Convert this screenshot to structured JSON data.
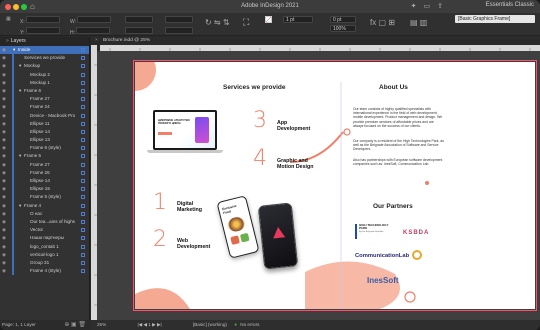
{
  "app": {
    "title": "Adobe InDesign 2021",
    "workspace": "Essentials Classic",
    "frame_type": "[Basic Graphics Frame]"
  },
  "controls": {
    "stroke_weight": "1 pt",
    "zoom_percent": "100%",
    "opacity": "0 pt"
  },
  "panel": {
    "tab_label": "Layers",
    "footer": "Page: 1, 1 Layer"
  },
  "layers": [
    {
      "label": "Inside",
      "indent": 0,
      "expanded": true,
      "main": true
    },
    {
      "label": "Services we provide",
      "indent": 1
    },
    {
      "label": "Mockup",
      "indent": 1,
      "expanded": true
    },
    {
      "label": "Mockup 2",
      "indent": 2
    },
    {
      "label": "Mockup 1",
      "indent": 2
    },
    {
      "label": "Frame 6",
      "indent": 1,
      "expanded": true
    },
    {
      "label": "Frame 27",
      "indent": 2
    },
    {
      "label": "Frame 24",
      "indent": 2
    },
    {
      "label": "Device - Macbook Pro",
      "indent": 2
    },
    {
      "label": "Ellipse 11",
      "indent": 2
    },
    {
      "label": "Ellipse 14",
      "indent": 2
    },
    {
      "label": "Ellipse 13",
      "indent": 2
    },
    {
      "label": "Frame 6 (style)",
      "indent": 2
    },
    {
      "label": "Frame 5",
      "indent": 1,
      "expanded": true
    },
    {
      "label": "Frame 27",
      "indent": 2
    },
    {
      "label": "Frame 26",
      "indent": 2
    },
    {
      "label": "Ellipse 14",
      "indent": 2
    },
    {
      "label": "Ellipse 15",
      "indent": 2
    },
    {
      "label": "Frame 5 (style)",
      "indent": 2
    },
    {
      "label": "Frame 4",
      "indent": 1,
      "expanded": true
    },
    {
      "label": "О нас",
      "indent": 2
    },
    {
      "label": "Our tea...ains of highs",
      "indent": 2
    },
    {
      "label": "Vector",
      "indent": 2
    },
    {
      "label": "Наши партнеры",
      "indent": 2
    },
    {
      "label": "logo_contab 1",
      "indent": 2
    },
    {
      "label": "vertical-logo 1",
      "indent": 2
    },
    {
      "label": "Group 31",
      "indent": 2
    },
    {
      "label": "Frame 4 (style)",
      "indent": 2
    }
  ],
  "document": {
    "tab": "Brochure.indd @ 25%",
    "status_zoom": "25%",
    "status_page": "1",
    "status_style": "[Basic] (working)",
    "status_errors": "No errors"
  },
  "brochure": {
    "services_title": "Services we provide",
    "about_title": "About Us",
    "partners_title": "Our Partners",
    "services": [
      {
        "num": "1",
        "label": "Digital\nMarketing"
      },
      {
        "num": "2",
        "label": "Web\nDevelopment"
      },
      {
        "num": "3",
        "label": "App\nDevelopment"
      },
      {
        "num": "4",
        "label": "Graphic and\nMotion Design"
      }
    ],
    "about_paragraphs": [
      "Our team consists of highly qualified specialists with international experience in the field of web development, mobile development. Product management and design. We provide premium services of affordable prices and are always focused on the success of our clients.",
      "Our company is a resident of the High Technologies Park, as well as the Belgrade Association of Software and Service Developers.",
      "Also has partnerships with European software development companies such as: InesSoft, Communication Lab"
    ],
    "partners": [
      {
        "name": "HIGH TECHNOLOGY PARK",
        "sub": "By the Belgrade Republic"
      },
      {
        "name": "KSBDA"
      },
      {
        "name": "CommunicationLab"
      },
      {
        "name": "InesSoft"
      }
    ],
    "laptop_screen_text": "ЦИФРОВОЕ АГЕНТСТВО ПОЛНОГО ЦИКЛА",
    "phone_screen_text": "Exclusive\nFood",
    "colors": {
      "accent": "#f08068",
      "blob": "#f5a993",
      "panel_sel": "#3f6fb8"
    }
  }
}
